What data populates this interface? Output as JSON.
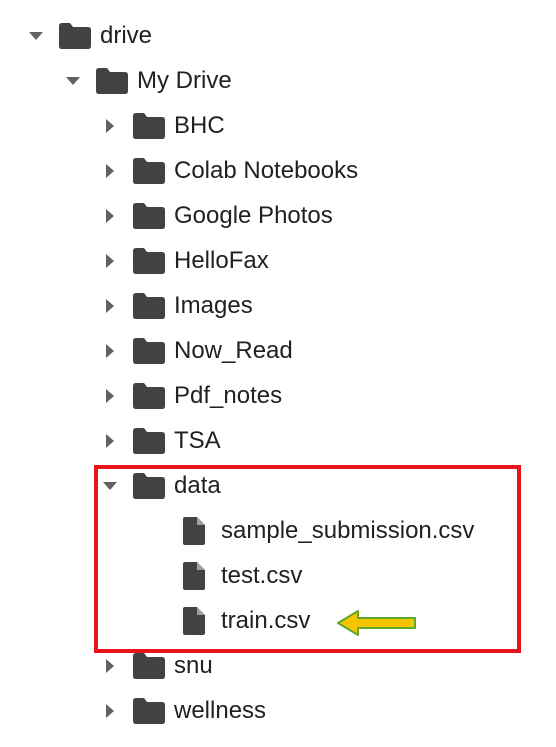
{
  "tree": {
    "root": {
      "label": "drive",
      "expanded": true
    },
    "my_drive": {
      "label": "My Drive",
      "expanded": true
    },
    "folders": [
      {
        "label": "BHC",
        "expanded": false
      },
      {
        "label": "Colab Notebooks",
        "expanded": false
      },
      {
        "label": "Google Photos",
        "expanded": false
      },
      {
        "label": "HelloFax",
        "expanded": false
      },
      {
        "label": "Images",
        "expanded": false
      },
      {
        "label": "Now_Read",
        "expanded": false
      },
      {
        "label": "Pdf_notes",
        "expanded": false
      },
      {
        "label": "TSA",
        "expanded": false
      }
    ],
    "data_folder": {
      "label": "data",
      "expanded": true,
      "files": [
        {
          "label": "sample_submission.csv"
        },
        {
          "label": "test.csv"
        },
        {
          "label": "train.csv"
        }
      ]
    },
    "trailing_folders": [
      {
        "label": "snu",
        "expanded": false
      },
      {
        "label": "wellness",
        "expanded": false
      }
    ]
  },
  "annotations": {
    "highlight_color": "#e8141c",
    "arrow_fill": "#f6c400",
    "arrow_stroke": "#5fa82a",
    "arrow_target": "train.csv"
  },
  "colors": {
    "icon": "#424242",
    "text": "#212121",
    "chevron": "#616161"
  }
}
